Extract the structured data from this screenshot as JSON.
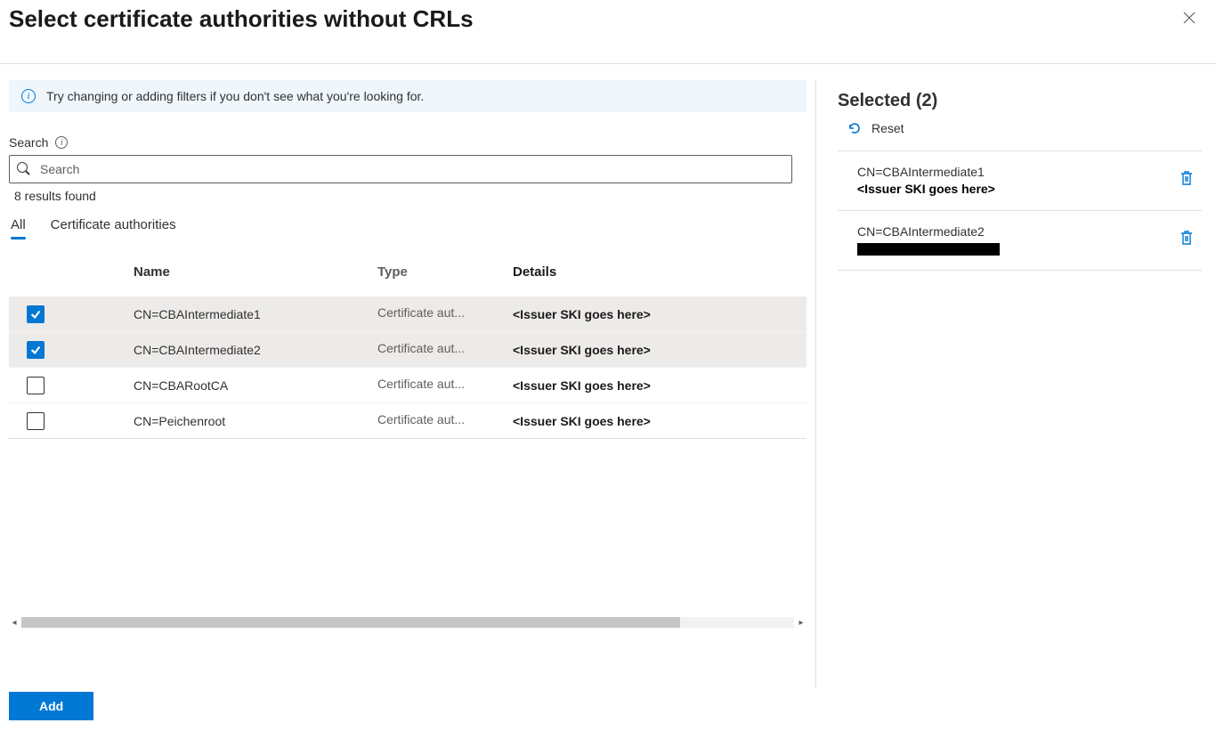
{
  "header": {
    "title": "Select certificate authorities without CRLs"
  },
  "info_banner": "Try changing or adding filters if you don't see what you're looking for.",
  "search": {
    "label": "Search",
    "placeholder": "Search",
    "results_found": "8 results found"
  },
  "tabs": {
    "all": "All",
    "ca": "Certificate authorities"
  },
  "table": {
    "headers": {
      "name": "Name",
      "type": "Type",
      "details": "Details"
    },
    "rows": [
      {
        "checked": true,
        "name": "CN=CBAIntermediate1",
        "type": "Certificate aut...",
        "details": "<Issuer SKI goes here>"
      },
      {
        "checked": true,
        "name": "CN=CBAIntermediate2",
        "type": "Certificate aut...",
        "details": "<Issuer SKI goes here>"
      },
      {
        "checked": false,
        "name": "CN=CBARootCA",
        "type": "Certificate aut...",
        "details": "<Issuer SKI goes here>"
      },
      {
        "checked": false,
        "name": "CN=Peichenroot",
        "type": "Certificate aut...",
        "details": "<Issuer SKI goes here>"
      }
    ]
  },
  "selected_panel": {
    "title": "Selected (2)",
    "reset": "Reset",
    "items": [
      {
        "name": "CN=CBAIntermediate1",
        "details": "<Issuer SKI goes here>",
        "redacted": false
      },
      {
        "name": "CN=CBAIntermediate2",
        "details": "",
        "redacted": true
      }
    ]
  },
  "footer": {
    "add": "Add"
  }
}
